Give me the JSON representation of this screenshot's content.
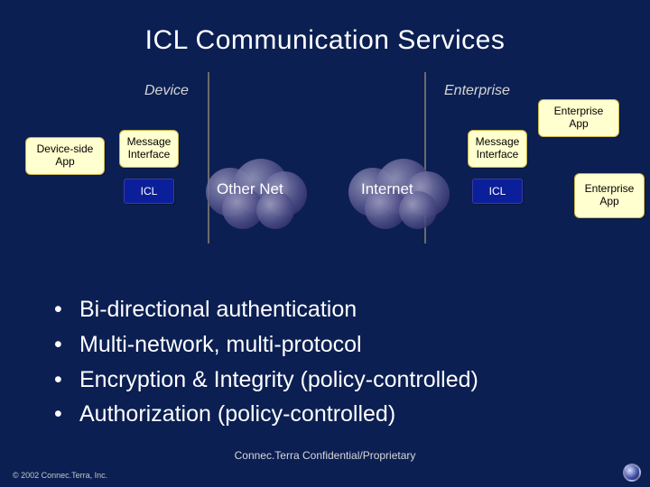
{
  "title": "ICL Communication Services",
  "columns": {
    "left": "Device",
    "right": "Enterprise"
  },
  "boxes": {
    "device_side_app": "Device-side\nApp",
    "msg_if_left": "Message\nInterface",
    "msg_if_right": "Message\nInterface",
    "ent_app_top": "Enterprise\nApp",
    "ent_app_bottom": "Enterprise\nApp",
    "icl_left": "ICL",
    "icl_right": "ICL"
  },
  "nets": {
    "other": "Other Net",
    "internet": "Internet"
  },
  "bullets": [
    "Bi-directional authentication",
    "Multi-network, multi-protocol",
    "Encryption & Integrity (policy-controlled)",
    "Authorization (policy-controlled)"
  ],
  "subfooter": "Connec.Terra Confidential/Proprietary",
  "copyright": "© 2002 Connec.Terra, Inc."
}
